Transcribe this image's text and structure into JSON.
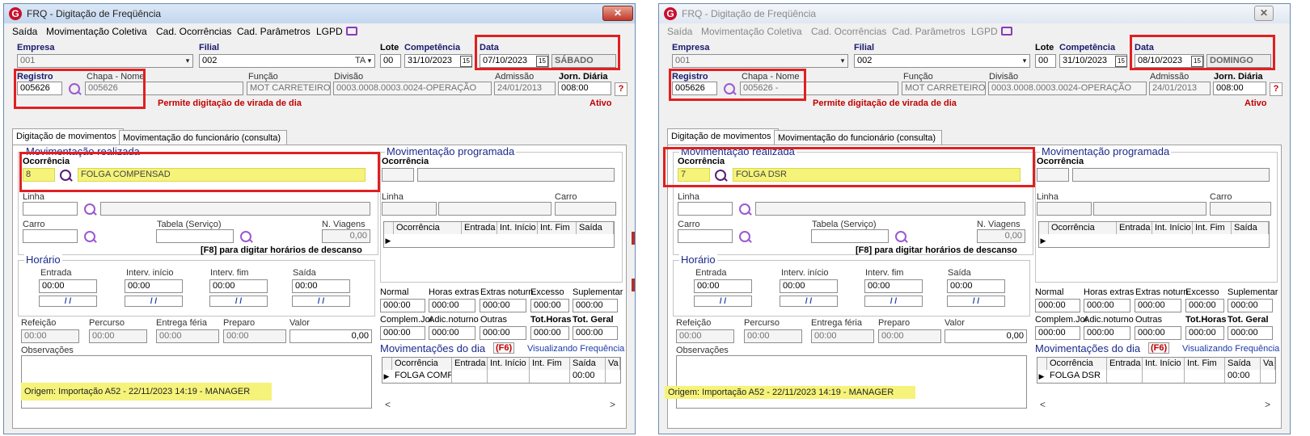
{
  "window": {
    "title": "FRQ - Digitação de Freqüência",
    "close_label": "✕"
  },
  "menu": {
    "items": [
      "Saída",
      "Movimentação Coletiva",
      "Cad. Ocorrências",
      "Cad. Parâmetros",
      "LGPD"
    ]
  },
  "labels": {
    "empresa": "Empresa",
    "filial": "Filial",
    "lote": "Lote",
    "competencia": "Competência",
    "data": "Data",
    "registro": "Registro",
    "chapa_nome": "Chapa  -  Nome",
    "funcao": "Função",
    "divisao": "Divisão",
    "admissao": "Admissão",
    "jornada": "Jorn. Diária",
    "tab_digitacao": "Digitação de movimentos",
    "tab_movimentacao": "Movimentação do funcionário (consulta)",
    "mov_realizada": "Movimentação realizada",
    "mov_programada": "Movimentação programada",
    "ocorrencia": "Ocorrência",
    "linha": "Linha",
    "carro": "Carro",
    "tabela": "Tabela (Serviço)",
    "n_viagens": "N. Viagens",
    "f8_hint": "[F8] para digitar horários de descanso",
    "horario": "Horário",
    "entrada": "Entrada",
    "interv_inicio": "Interv. início",
    "interv_fim": "Interv. fim",
    "saida": "Saída",
    "refeicao": "Refeição",
    "percurso": "Percurso",
    "entrega_feria": "Entrega féria",
    "preparo": "Preparo",
    "valor": "Valor",
    "observacoes": "Observações",
    "normal": "Normal",
    "horas_extras": "Horas extras",
    "extras_noturn": "Extras noturn.",
    "excesso": "Excesso",
    "suplementar": "Suplementar",
    "complem_jor": "Complem.Jor.",
    "adic_noturno": "Adic.noturno",
    "outras": "Outras",
    "tot_horas": "Tot.Horas",
    "tot_geral": "Tot. Geral",
    "mov_dia": "Movimentações do dia",
    "f6": "(F6)",
    "visualizando": "Visualizando Frequência",
    "prog_grid_cols": [
      "Ocorrência",
      "Entrada",
      "Int. Início",
      "Int. Fim",
      "Saída"
    ],
    "day_grid_cols": [
      "Ocorrência",
      "Entrada",
      "Int. Início",
      "Int. Fim",
      "Saída",
      "Va"
    ]
  },
  "left": {
    "empresa": "001",
    "filial": "002",
    "filial_suffix": "TA",
    "lote": "00",
    "competencia": "31/10/2023",
    "data": "07/10/2023",
    "dia_semana": "SÁBADO",
    "registro": "005626",
    "chapa": "005626",
    "funcao": "MOT CARRETEIRO",
    "divisao": "0003.0008.0003.0024-OPERAÇÃO",
    "admissao": "24/01/2013",
    "jornada": "008:00",
    "permite_virada": "Permite digitação de virada de dia",
    "status": "Ativo",
    "oc_codigo": "8",
    "oc_descricao": "FOLGA COMPENSAD",
    "n_viagens": "0,00",
    "horario": [
      "00:00",
      "00:00",
      "00:00",
      "00:00"
    ],
    "refeicao": "00:00",
    "percurso": "00:00",
    "entrega_feria": "00:00",
    "preparo": "00:00",
    "valor": "0,00",
    "totais1": [
      "000:00",
      "000:00",
      "000:00",
      "000:00",
      "000:00"
    ],
    "totais2": [
      "000:00",
      "000:00",
      "000:00",
      "000:00",
      "000:00"
    ],
    "dia_row": {
      "ocorrencia": "FOLGA COMPE",
      "saida": "00:00"
    },
    "origem": "Origem: Importação A52 - 22/11/2023 14:19 - MANAGER"
  },
  "right": {
    "empresa": "001",
    "filial": "002",
    "lote": "00",
    "competencia": "31/10/2023",
    "data": "08/10/2023",
    "dia_semana": "DOMINGO",
    "registro": "005626",
    "chapa": "005626 -",
    "funcao": "MOT CARRETEIRO",
    "divisao": "0003.0008.0003.0024-OPERAÇÃO",
    "admissao": "24/01/2013",
    "jornada": "008:00",
    "permite_virada": "Permite digitação de virada de dia",
    "status": "Ativo",
    "oc_codigo": "7",
    "oc_descricao": "FOLGA DSR",
    "n_viagens": "0,00",
    "horario": [
      "00:00",
      "00:00",
      "00:00",
      "00:00"
    ],
    "refeicao": "00:00",
    "percurso": "00:00",
    "entrega_feria": "00:00",
    "preparo": "00:00",
    "valor": "0,00",
    "totais1": [
      "000:00",
      "000:00",
      "000:00",
      "000:00",
      "000:00"
    ],
    "totais2": [
      "000:00",
      "000:00",
      "000:00",
      "000:00",
      "000:00"
    ],
    "dia_row": {
      "ocorrencia": "FOLGA DSR",
      "saida": "00:00"
    },
    "origem": "Origem: Importação A52 - 22/11/2023 14:19 - MANAGER"
  },
  "colors": {
    "highlight_yellow": "#f5f37a",
    "annotation_red": "#e02020",
    "accent_blue": "#1a2a8c",
    "warning_red": "#c00000"
  }
}
